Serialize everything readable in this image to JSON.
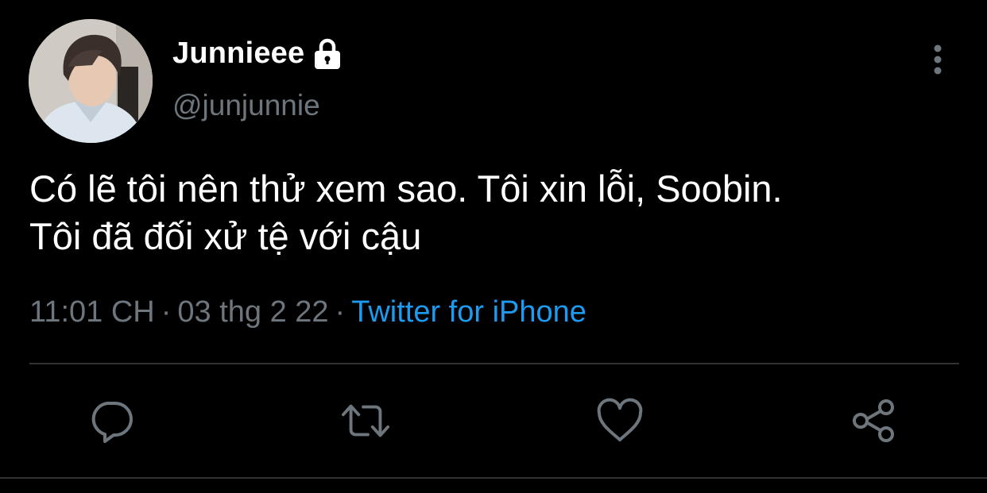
{
  "author": {
    "display_name": "Junnieee",
    "handle": "@junjunnie",
    "protected_icon": "lock-icon",
    "avatar": "profile-photo"
  },
  "tweet": {
    "text": "Có lẽ tôi nên thử xem sao. Tôi xin lỗi, Soobin.\nTôi đã đối xử tệ với cậu",
    "time": "11:01 CH",
    "date": "03 thg 2 22",
    "separator": "·",
    "source": "Twitter for iPhone"
  },
  "actions": [
    {
      "name": "reply",
      "icon": "speech-bubble-icon"
    },
    {
      "name": "retweet",
      "icon": "retweet-arrows-icon"
    },
    {
      "name": "like",
      "icon": "heart-icon"
    },
    {
      "name": "share",
      "icon": "share-nodes-icon"
    }
  ],
  "menu": {
    "icon": "vertical-ellipsis-icon"
  },
  "colors": {
    "background": "#000000",
    "text": "#ffffff",
    "muted": "#6e767d",
    "link": "#1d9bf0",
    "divider": "#2f3336"
  }
}
